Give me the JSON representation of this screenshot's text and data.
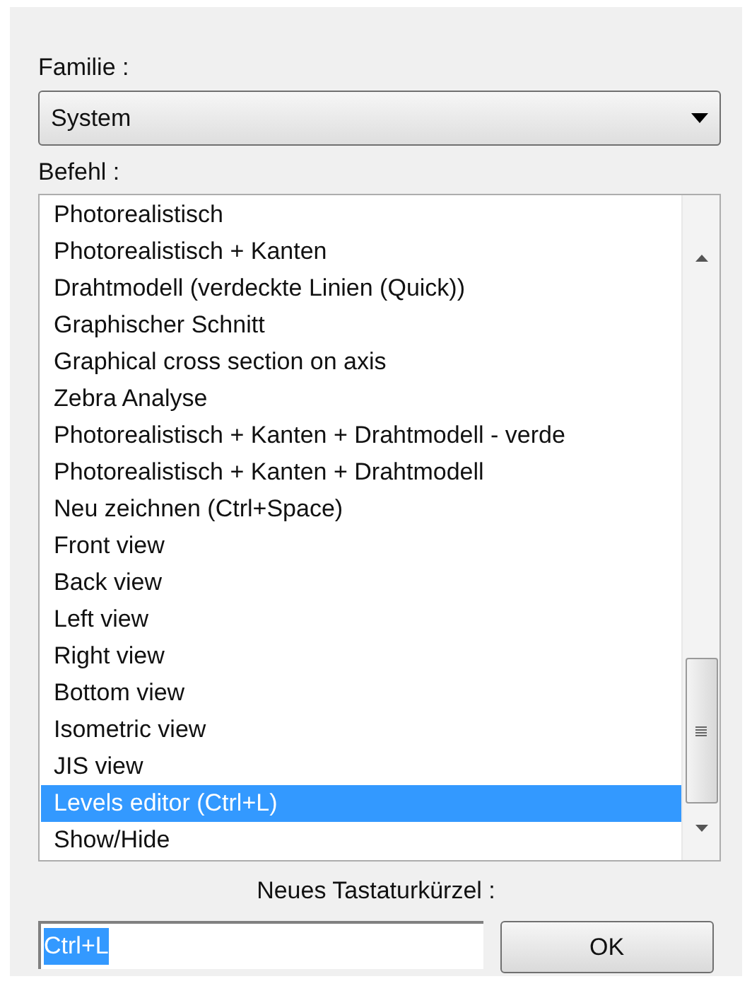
{
  "family": {
    "label": "Familie :",
    "value": "System"
  },
  "command": {
    "label": "Befehl :",
    "items": [
      {
        "label": "Photorealistisch",
        "selected": false
      },
      {
        "label": "Photorealistisch + Kanten",
        "selected": false
      },
      {
        "label": "Drahtmodell (verdeckte Linien (Quick))",
        "selected": false
      },
      {
        "label": "Graphischer Schnitt",
        "selected": false
      },
      {
        "label": "Graphical cross section on axis",
        "selected": false
      },
      {
        "label": "Zebra Analyse",
        "selected": false
      },
      {
        "label": "Photorealistisch + Kanten + Drahtmodell - verde",
        "selected": false
      },
      {
        "label": "Photorealistisch + Kanten + Drahtmodell",
        "selected": false
      },
      {
        "label": "Neu zeichnen (Ctrl+Space)",
        "selected": false
      },
      {
        "label": "Front view",
        "selected": false
      },
      {
        "label": "Back view",
        "selected": false
      },
      {
        "label": "Left view",
        "selected": false
      },
      {
        "label": "Right view",
        "selected": false
      },
      {
        "label": "Bottom view",
        "selected": false
      },
      {
        "label": "Isometric view",
        "selected": false
      },
      {
        "label": "JIS view",
        "selected": false
      },
      {
        "label": "Levels editor (Ctrl+L)",
        "selected": true
      },
      {
        "label": "Show/Hide",
        "selected": false
      }
    ]
  },
  "shortcut": {
    "label": "Neues Tastaturkürzel :",
    "value": "Ctrl+L"
  },
  "ok_button": "OK"
}
